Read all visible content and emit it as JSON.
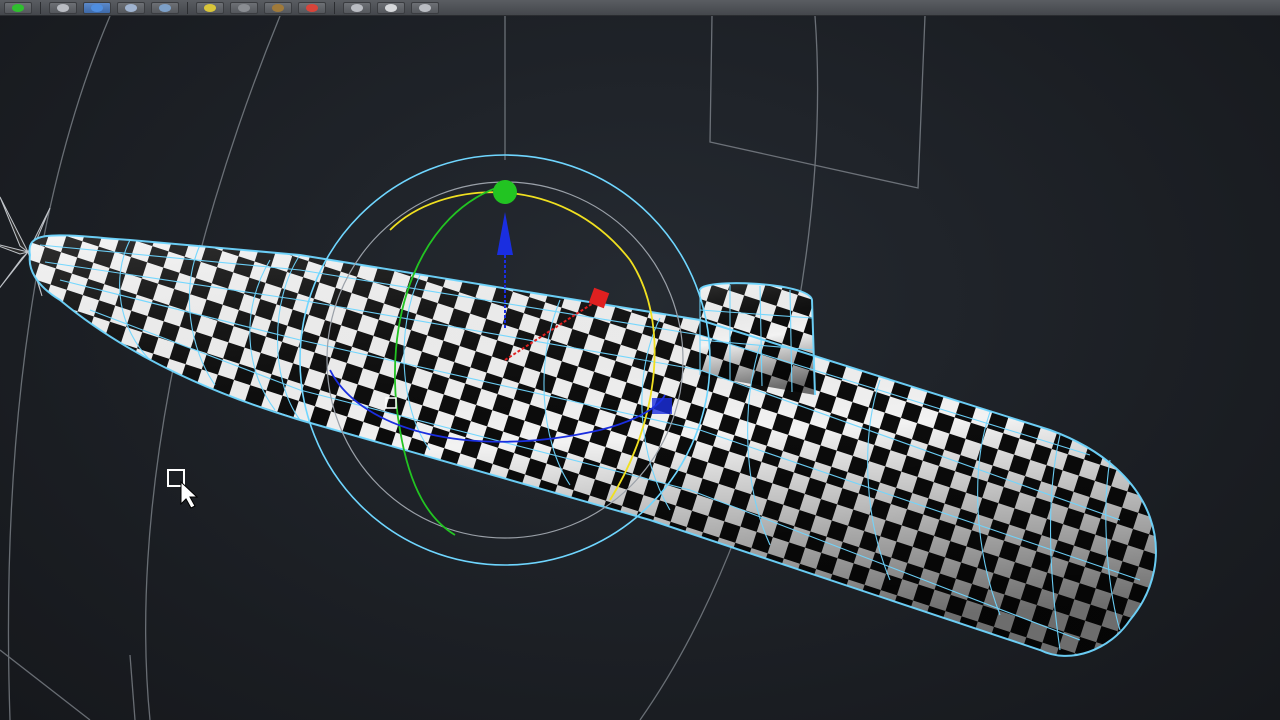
{
  "app": {
    "view": "3D Viewport"
  },
  "toolbar": {
    "buttons": [
      {
        "icon": "green-square-icon",
        "color": "#2fbf2f"
      },
      {
        "icon": "render-frame-icon",
        "color": "#b9bcc2"
      },
      {
        "icon": "blue-teapot-icon",
        "color": "#4f8ee0",
        "active": true
      },
      {
        "icon": "teapot-icon",
        "color": "#9fb3d0"
      },
      {
        "icon": "info-icon",
        "color": "#7da0c8"
      },
      {
        "icon": "yellow-sphere-icon",
        "color": "#d8c53a"
      },
      {
        "icon": "gray-cylinder-icon",
        "color": "#8a8d92"
      },
      {
        "icon": "bronze-sphere-icon",
        "color": "#a07a3a"
      },
      {
        "icon": "red-arrow-icon",
        "color": "#d8443a"
      },
      {
        "icon": "box-icon",
        "color": "#b9bcc2"
      },
      {
        "icon": "frame-icon",
        "color": "#d6d8db"
      },
      {
        "icon": "wrench-icon",
        "color": "#b9bcc2"
      }
    ]
  },
  "colors": {
    "wireframe": "#6fd6ff",
    "gizmo_x": "#e02020",
    "gizmo_y": "#22c422",
    "gizmo_z": "#1a2ee0",
    "gizmo_ring": "#f0e020",
    "grid": "#aab0b8"
  },
  "selection": {
    "object": "submarine-mesh",
    "tool": "rotate-gizmo"
  }
}
